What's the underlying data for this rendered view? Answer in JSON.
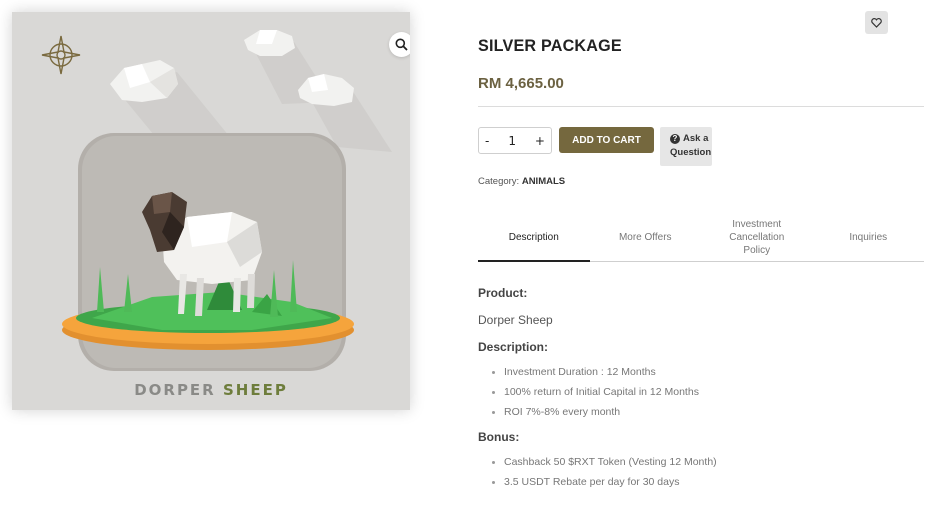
{
  "product": {
    "title": "SILVER PACKAGE",
    "price": "RM 4,665.00",
    "image_caption_word1": "DORPER",
    "image_caption_word2": "SHEEP"
  },
  "actions": {
    "qty_minus": "-",
    "qty_value": "1",
    "qty_plus": "+",
    "add_to_cart": "ADD TO CART",
    "ask_line1": "Ask a",
    "ask_line2": "Question",
    "ask_icon": "?"
  },
  "category": {
    "label": "Category:",
    "value": "ANIMALS"
  },
  "tabs": [
    {
      "label": "Description"
    },
    {
      "label": "More Offers"
    },
    {
      "label": "Investment Cancellation Policy"
    },
    {
      "label": "Inquiries"
    }
  ],
  "description": {
    "product_label": "Product:",
    "product_value": "Dorper Sheep",
    "description_label": "Description:",
    "description_items": [
      "Investment Duration : 12 Months",
      "100% return of Initial Capital in 12 Months",
      "ROI 7%-8% every month"
    ],
    "bonus_label": "Bonus:",
    "bonus_items": [
      "Cashback 50 $RXT Token (Vesting 12 Month)",
      "3.5 USDT Rebate per day for 30 days"
    ]
  },
  "icons": {
    "zoom": "search-icon",
    "wishlist": "heart-icon",
    "logo": "compass-logo-icon"
  },
  "colors": {
    "accent": "#75683e",
    "price": "#6b6141",
    "card_bg": "#d9d8d6"
  }
}
